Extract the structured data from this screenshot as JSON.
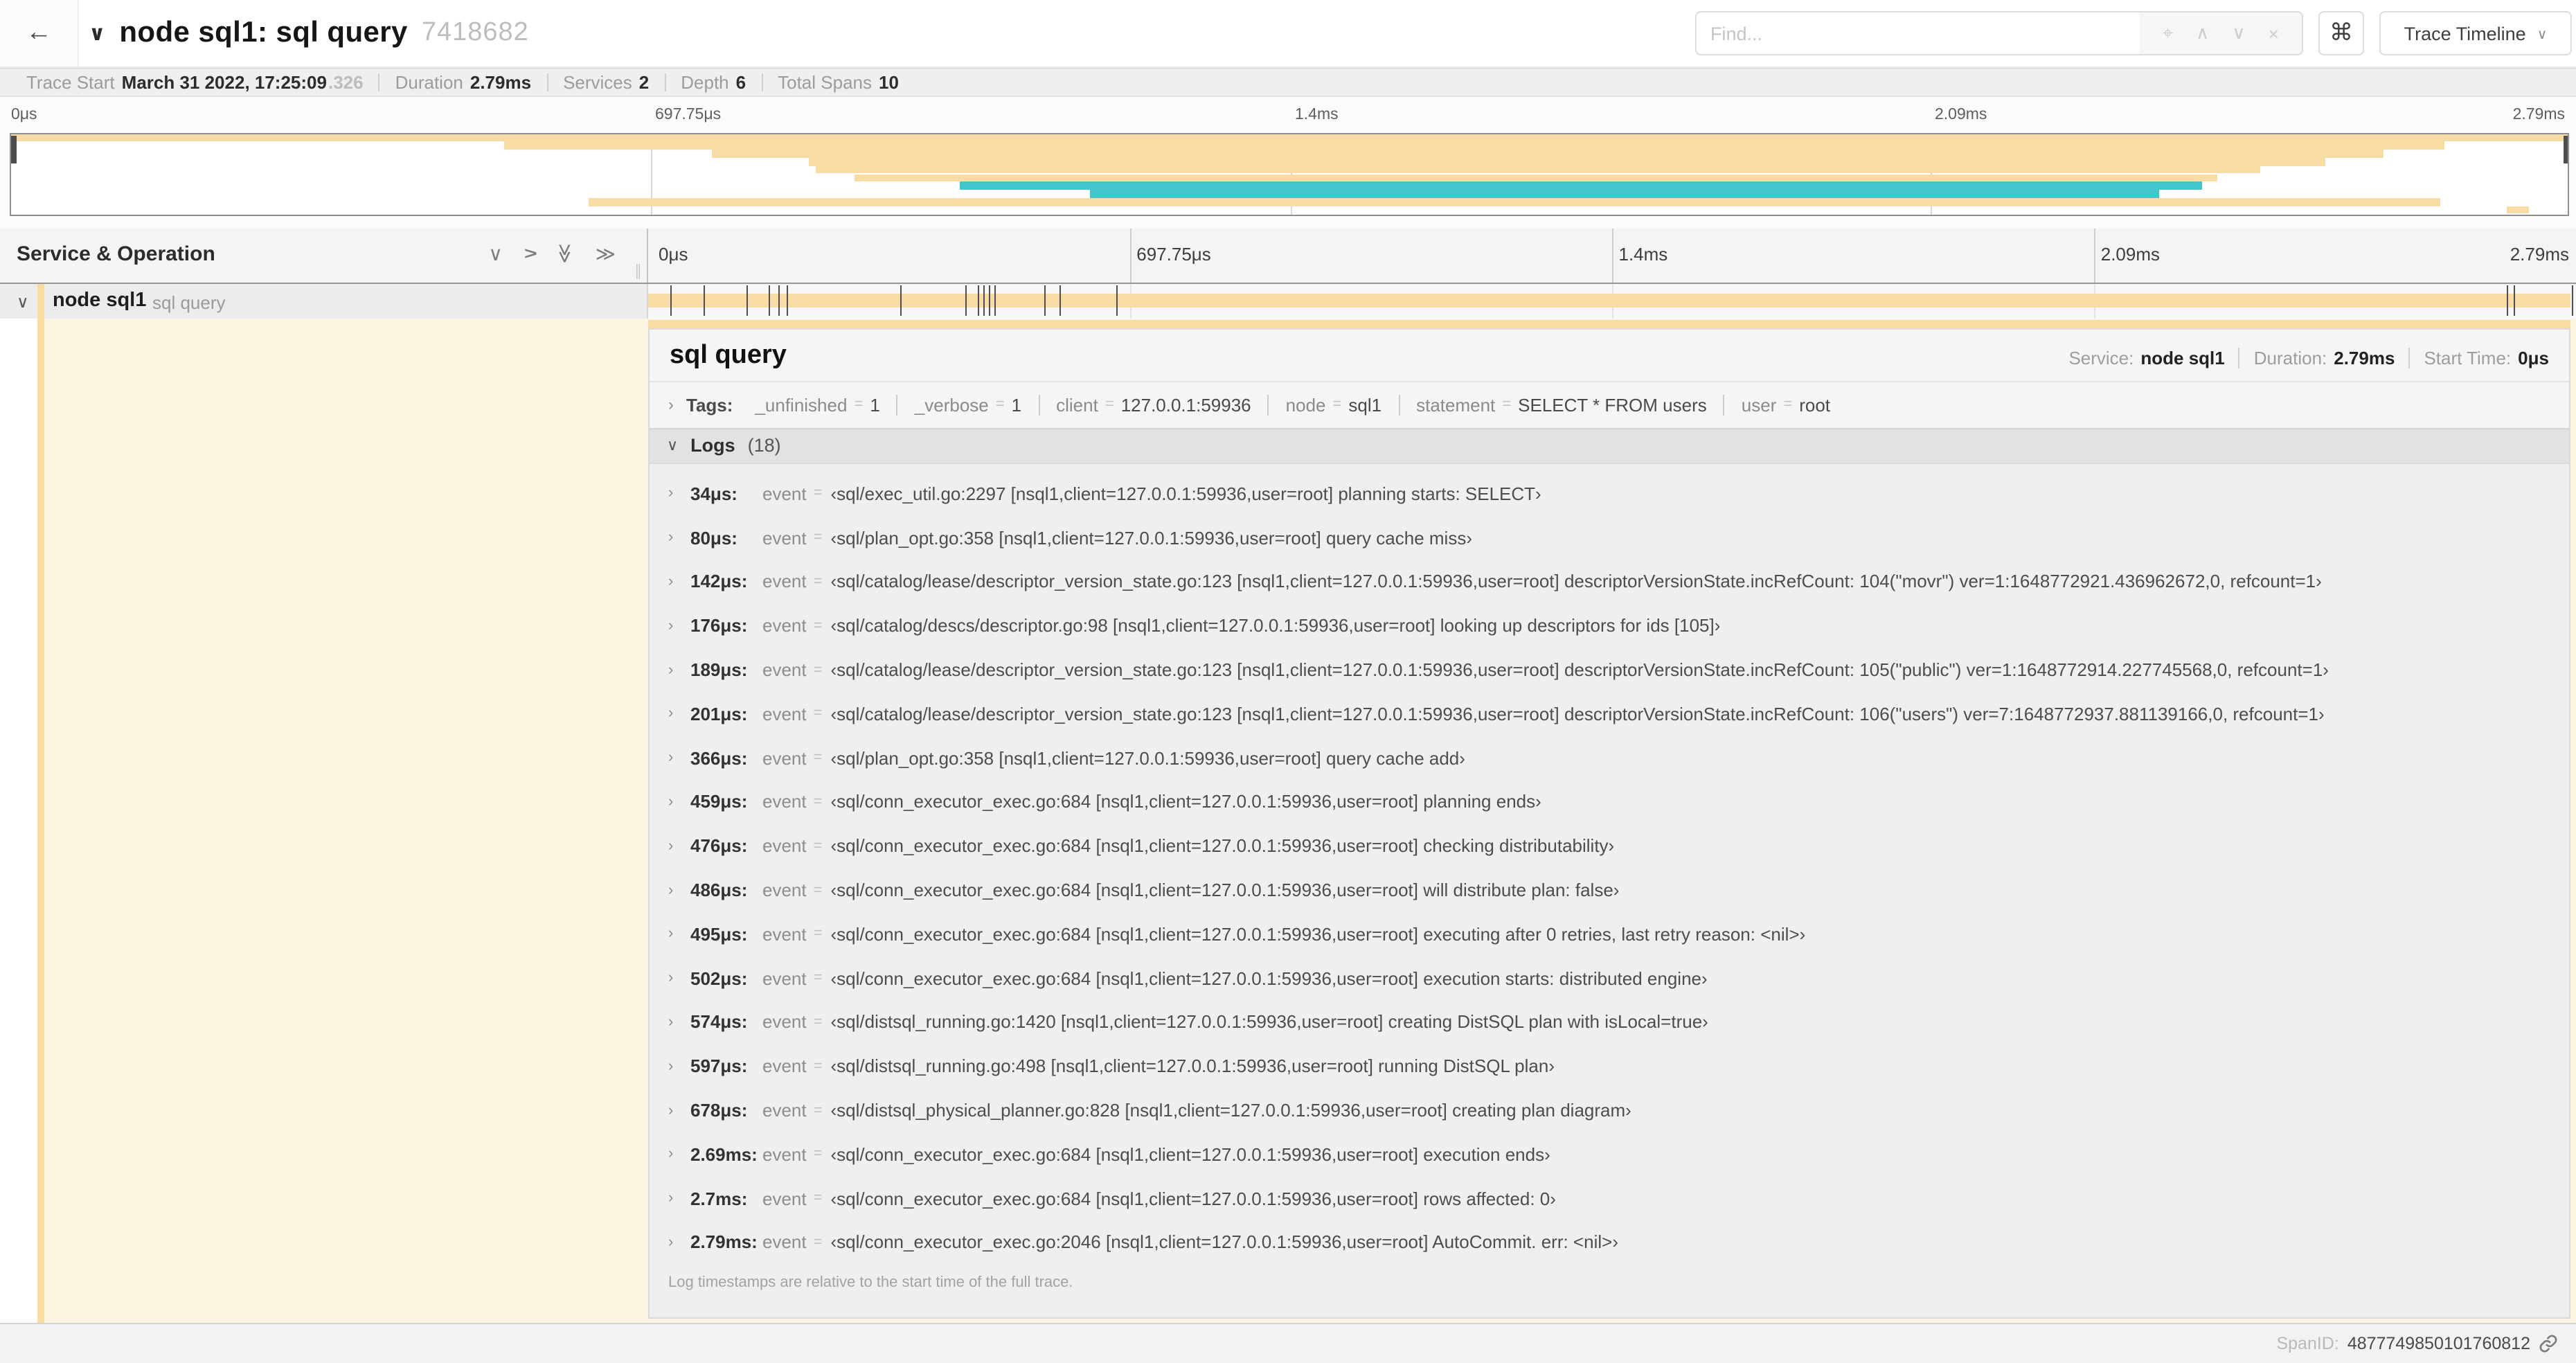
{
  "colors": {
    "tan": "#f7dca4",
    "teal": "#41c6cb",
    "cream": "#fcf5e2"
  },
  "header": {
    "back_icon": "←",
    "collapse_icon": "∨",
    "title": "node sql1: sql query",
    "trace_id_short": "7418682",
    "find_placeholder": "Find...",
    "locate_icon": "⌖",
    "prev_icon": "∧",
    "next_icon": "∨",
    "clear_icon": "×",
    "shortcut_icon": "⌘",
    "view_selector_label": "Trace Timeline",
    "view_selector_chevron": "∨"
  },
  "trace_meta": [
    {
      "label": "Trace Start",
      "value": "March 31 2022, 17:25:09",
      "suffix": ".326"
    },
    {
      "label": "Duration",
      "value": "2.79ms"
    },
    {
      "label": "Services",
      "value": "2"
    },
    {
      "label": "Depth",
      "value": "6"
    },
    {
      "label": "Total Spans",
      "value": "10"
    }
  ],
  "timeline": {
    "ticks": [
      {
        "label": "0μs",
        "pct": 0
      },
      {
        "label": "697.75μs",
        "pct": 25
      },
      {
        "label": "1.4ms",
        "pct": 50
      },
      {
        "label": "2.09ms",
        "pct": 75
      },
      {
        "label": "2.79ms",
        "pct": 100
      }
    ]
  },
  "minimap": {
    "spans": [
      {
        "start": 0,
        "end": 100,
        "color": "tan"
      },
      {
        "start": 19.3,
        "end": 95.2,
        "color": "tan"
      },
      {
        "start": 27.4,
        "end": 92.8,
        "color": "tan"
      },
      {
        "start": 31.2,
        "end": 90.5,
        "color": "tan"
      },
      {
        "start": 31.5,
        "end": 88.0,
        "color": "tan"
      },
      {
        "start": 33.0,
        "end": 86.3,
        "color": "tan"
      },
      {
        "start": 37.1,
        "end": 85.7,
        "color": "teal"
      },
      {
        "start": 42.2,
        "end": 84.0,
        "color": "teal"
      },
      {
        "start": 22.6,
        "end": 95.0,
        "color": "tan"
      },
      {
        "start": 97.6,
        "end": 98.5,
        "color": "tan"
      }
    ]
  },
  "colhead": {
    "title": "Service & Operation",
    "grip_icon": "∥"
  },
  "span_row": {
    "expander_icon": "∨",
    "service": "node sql1",
    "operation": "sql query",
    "bar": {
      "start": 0,
      "end": 100,
      "color": "tan"
    },
    "log_marker_pcts": [
      1.2,
      2.9,
      5.1,
      6.3,
      6.8,
      7.2,
      13.1,
      16.5,
      17.1,
      17.4,
      17.7,
      18.0,
      20.6,
      21.4,
      24.3,
      96.4,
      96.8,
      99.8
    ]
  },
  "detail": {
    "operation": "sql query",
    "meta": [
      {
        "label": "Service:",
        "value": "node sql1"
      },
      {
        "label": "Duration:",
        "value": "2.79ms"
      },
      {
        "label": "Start Time:",
        "value": "0μs"
      }
    ],
    "tags_chevron": "›",
    "tags_label": "Tags:",
    "tags": [
      {
        "key": "_unfinished",
        "value": "1"
      },
      {
        "key": "_verbose",
        "value": "1"
      },
      {
        "key": "client",
        "value": "127.0.0.1:59936"
      },
      {
        "key": "node",
        "value": "sql1"
      },
      {
        "key": "statement",
        "value": "SELECT * FROM users"
      },
      {
        "key": "user",
        "value": "root"
      }
    ],
    "logs_chevron": "∨",
    "logs_label": "Logs",
    "logs_count": "(18)",
    "log_field_name": "event",
    "logs": [
      {
        "time": "34μs:",
        "value": "‹sql/exec_util.go:2297 [nsql1,client=127.0.0.1:59936,user=root] planning starts: SELECT›"
      },
      {
        "time": "80μs:",
        "value": "‹sql/plan_opt.go:358 [nsql1,client=127.0.0.1:59936,user=root] query cache miss›"
      },
      {
        "time": "142μs:",
        "value": "‹sql/catalog/lease/descriptor_version_state.go:123 [nsql1,client=127.0.0.1:59936,user=root] descriptorVersionState.incRefCount: 104(\"movr\") ver=1:1648772921.436962672,0, refcount=1›"
      },
      {
        "time": "176μs:",
        "value": "‹sql/catalog/descs/descriptor.go:98 [nsql1,client=127.0.0.1:59936,user=root] looking up descriptors for ids [105]›"
      },
      {
        "time": "189μs:",
        "value": "‹sql/catalog/lease/descriptor_version_state.go:123 [nsql1,client=127.0.0.1:59936,user=root] descriptorVersionState.incRefCount: 105(\"public\") ver=1:1648772914.227745568,0, refcount=1›"
      },
      {
        "time": "201μs:",
        "value": "‹sql/catalog/lease/descriptor_version_state.go:123 [nsql1,client=127.0.0.1:59936,user=root] descriptorVersionState.incRefCount: 106(\"users\") ver=7:1648772937.881139166,0, refcount=1›"
      },
      {
        "time": "366μs:",
        "value": "‹sql/plan_opt.go:358 [nsql1,client=127.0.0.1:59936,user=root] query cache add›"
      },
      {
        "time": "459μs:",
        "value": "‹sql/conn_executor_exec.go:684 [nsql1,client=127.0.0.1:59936,user=root] planning ends›"
      },
      {
        "time": "476μs:",
        "value": "‹sql/conn_executor_exec.go:684 [nsql1,client=127.0.0.1:59936,user=root] checking distributability›"
      },
      {
        "time": "486μs:",
        "value": "‹sql/conn_executor_exec.go:684 [nsql1,client=127.0.0.1:59936,user=root] will distribute plan: false›"
      },
      {
        "time": "495μs:",
        "value": "‹sql/conn_executor_exec.go:684 [nsql1,client=127.0.0.1:59936,user=root] executing after 0 retries, last retry reason: <nil>›"
      },
      {
        "time": "502μs:",
        "value": "‹sql/conn_executor_exec.go:684 [nsql1,client=127.0.0.1:59936,user=root] execution starts: distributed engine›"
      },
      {
        "time": "574μs:",
        "value": "‹sql/distsql_running.go:1420 [nsql1,client=127.0.0.1:59936,user=root] creating DistSQL plan with isLocal=true›"
      },
      {
        "time": "597μs:",
        "value": "‹sql/distsql_running.go:498 [nsql1,client=127.0.0.1:59936,user=root] running DistSQL plan›"
      },
      {
        "time": "678μs:",
        "value": "‹sql/distsql_physical_planner.go:828 [nsql1,client=127.0.0.1:59936,user=root] creating plan diagram›"
      },
      {
        "time": "2.69ms:",
        "value": "‹sql/conn_executor_exec.go:684 [nsql1,client=127.0.0.1:59936,user=root] execution ends›"
      },
      {
        "time": "2.7ms:",
        "value": "‹sql/conn_executor_exec.go:684 [nsql1,client=127.0.0.1:59936,user=root] rows affected: 0›"
      },
      {
        "time": "2.79ms:",
        "value": "‹sql/conn_executor_exec.go:2046 [nsql1,client=127.0.0.1:59936,user=root] AutoCommit. err: <nil>›"
      }
    ],
    "logs_note": "Log timestamps are relative to the start time of the full trace.",
    "spanid_label": "SpanID:",
    "spanid": "4877749850101760812"
  }
}
